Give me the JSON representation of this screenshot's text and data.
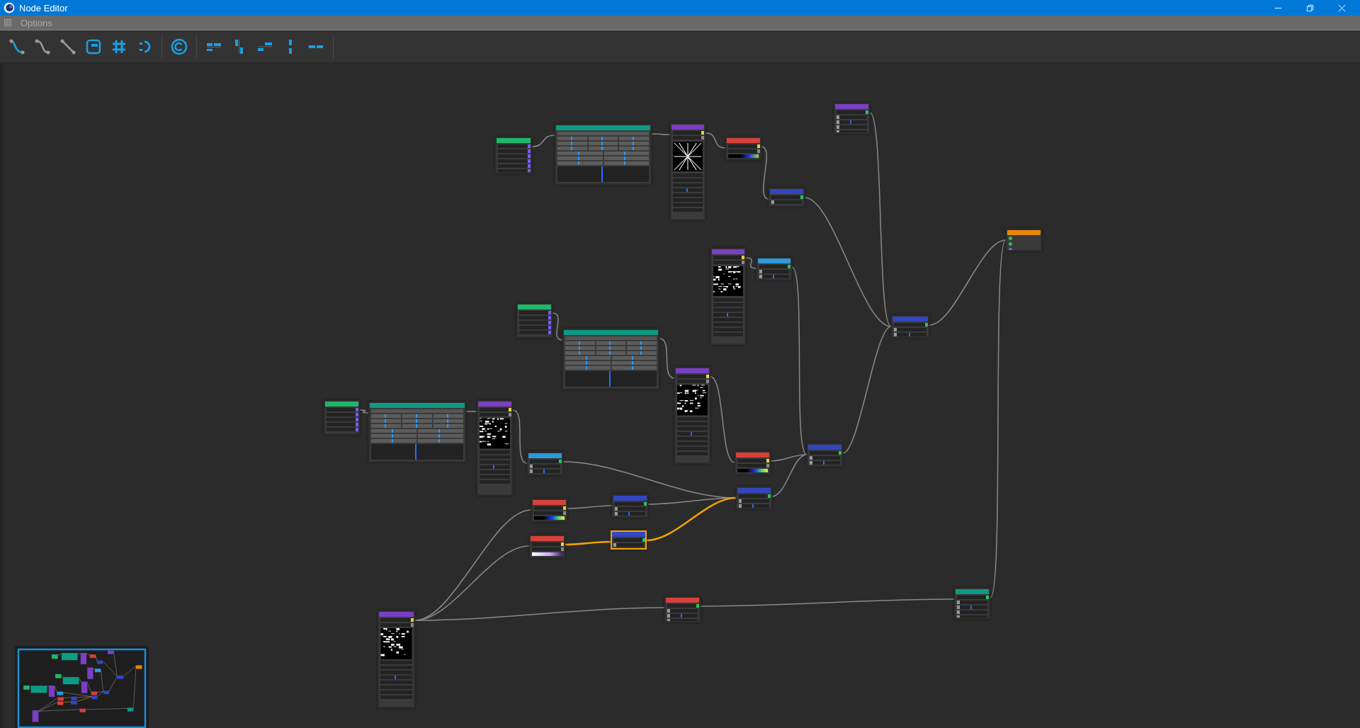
{
  "window": {
    "title": "Node Editor"
  },
  "menu": [
    "Options"
  ],
  "nodes": [
    {
      "kind": "input",
      "color": "#1fb86a",
      "selected": false
    },
    {
      "kind": "table",
      "color": "#0d9a86",
      "selected": false
    },
    {
      "kind": "texture",
      "color": "#7a3fc4",
      "selected": false
    },
    {
      "kind": "gradient",
      "color": "#d8403a",
      "selected": false
    },
    {
      "kind": "math",
      "color": "#3346c0",
      "selected": false
    },
    {
      "kind": "math",
      "color": "#7a3fc4",
      "selected": false
    },
    {
      "kind": "output",
      "color": "#e8860c",
      "selected": false
    },
    {
      "kind": "math",
      "color": "#3346c0",
      "selected": false
    },
    {
      "kind": "texture",
      "color": "#7a3fc4",
      "selected": false
    },
    {
      "kind": "math",
      "color": "#2a9ad8",
      "selected": false
    },
    {
      "kind": "input",
      "color": "#1fb86a",
      "selected": false
    },
    {
      "kind": "table",
      "color": "#0d9a86",
      "selected": false
    },
    {
      "kind": "texture",
      "color": "#7a3fc4",
      "selected": false
    },
    {
      "kind": "input",
      "color": "#1fb86a",
      "selected": false
    },
    {
      "kind": "table",
      "color": "#0d9a86",
      "selected": false
    },
    {
      "kind": "texture",
      "color": "#7a3fc4",
      "selected": false
    },
    {
      "kind": "math",
      "color": "#2a9ad8",
      "selected": false
    },
    {
      "kind": "gradient",
      "color": "#d8403a",
      "selected": false
    },
    {
      "kind": "math",
      "color": "#3346c0",
      "selected": false
    },
    {
      "kind": "math",
      "color": "#3346c0",
      "selected": false
    },
    {
      "kind": "gradient",
      "color": "#d8403a",
      "selected": false
    },
    {
      "kind": "math",
      "color": "#3346c0",
      "selected": false
    },
    {
      "kind": "gradient",
      "color": "#d8403a",
      "selected": false
    },
    {
      "kind": "math",
      "color": "#3346c0",
      "selected": true
    },
    {
      "kind": "math",
      "color": "#d8403a",
      "selected": false
    },
    {
      "kind": "math",
      "color": "#0d9a86",
      "selected": false
    },
    {
      "kind": "texture",
      "color": "#7a3fc4",
      "selected": false
    }
  ]
}
